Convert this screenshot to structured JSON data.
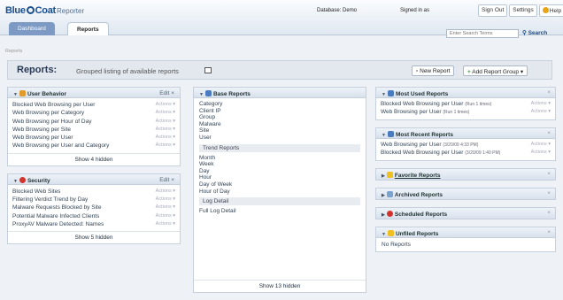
{
  "top": {
    "logo_a": "Blue",
    "logo_b": "Coat",
    "app": "Reporter",
    "database": "Database: Demo",
    "signed": "Signed in as",
    "signout": "Sign Out",
    "settings": "Settings",
    "help": "Help",
    "tabs": [
      "Dashboard",
      "Reports"
    ],
    "search_placeholder": "Enter Search Terms",
    "search_btn": "Search"
  },
  "crumb": "Reports",
  "header": {
    "title": "Reports:",
    "subtitle": "Grouped listing of available reports",
    "new_report": "New Report",
    "add_group": "Add Report Group"
  },
  "user_behavior": {
    "title": "User Behavior",
    "edit": "Edit",
    "actions": "Actions",
    "items": [
      "Blocked Web Browsing per User",
      "Web Browsing per Category",
      "Web Browsing per Hour of Day",
      "Web Browsing per Site",
      "Web Browsing per User",
      "Web Browsing per User and Category"
    ],
    "show": "Show 4 hidden"
  },
  "security": {
    "title": "Security",
    "edit": "Edit",
    "actions": "Actions",
    "items": [
      "Blocked Web Sites",
      "Filtering Verdict Trend by Day",
      "Malware Requests Blocked by Site",
      "Potential Malware Infected Clients",
      "ProxyAV Malware Detected: Names"
    ],
    "show": "Show 5 hidden"
  },
  "base": {
    "title": "Base Reports",
    "items": [
      "Category",
      "Client IP",
      "Group",
      "Malware",
      "Site",
      "User"
    ],
    "trend_title": "Trend Reports",
    "trend": [
      "Month",
      "Week",
      "Day",
      "Hour",
      "Day of Week",
      "Hour of Day"
    ],
    "log_title": "Log Detail",
    "log": [
      "Full Log Detail"
    ],
    "show": "Show 13 hidden"
  },
  "most_used": {
    "title": "Most Used Reports",
    "actions": "Actions",
    "items": [
      {
        "name": "Blocked Web Browsing per User",
        "note": "(Run 1 times)"
      },
      {
        "name": "Web Browsing per User",
        "note": "(Run 1 times)"
      }
    ]
  },
  "most_recent": {
    "title": "Most Recent Reports",
    "actions": "Actions",
    "items": [
      {
        "name": "Web Browsing per User",
        "note": "(3/20/09 4:33 PM)"
      },
      {
        "name": "Blocked Web Browsing per User",
        "note": "(3/20/09 1:40 PM)"
      }
    ]
  },
  "collapsed": [
    "Favorite Reports",
    "Archived Reports",
    "Scheduled Reports"
  ],
  "unfiled": {
    "title": "Unfiled Reports",
    "text": "No Reports"
  }
}
